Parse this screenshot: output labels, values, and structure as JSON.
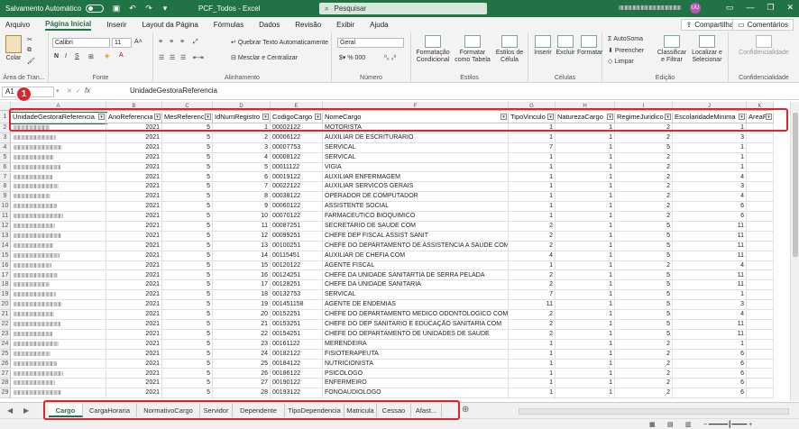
{
  "titlebar": {
    "autosave_label": "Salvamento Automático",
    "doc_title": "PCF_Todos  -  Excel",
    "search_placeholder": "Pesquisar",
    "user_initials": "UU"
  },
  "menu": [
    "Arquivo",
    "Página Inicial",
    "Inserir",
    "Layout da Página",
    "Fórmulas",
    "Dados",
    "Revisão",
    "Exibir",
    "Ajuda"
  ],
  "menu_active": 1,
  "share_label": "Compartilhar",
  "comments_label": "Comentários",
  "ribbon": {
    "paste": "Colar",
    "clipboard_group": "Área de Tran...",
    "font_name": "Calibri",
    "font_size": "11",
    "font_group": "Fonte",
    "wrap_text": "Quebrar Texto Automaticamente",
    "merge_center": "Mesclar e Centralizar",
    "alignment_group": "Alinhamento",
    "number_format": "Geral",
    "number_group": "Número",
    "cond_format": "Formatação Condicional",
    "format_table": "Formatar como Tabela",
    "cell_styles": "Estilos de Célula",
    "styles_group": "Estilos",
    "insert": "Inserir",
    "delete": "Excluir",
    "format": "Formatar",
    "cells_group": "Células",
    "autosum": "AutoSoma",
    "fill": "Preencher",
    "clear": "Limpar",
    "sort_filter": "Classificar e Filtrar",
    "find_select": "Localizar e Selecionar",
    "editing_group": "Edição",
    "confidentiality": "Confidencialidade",
    "confidentiality_group": "Confidencialidade"
  },
  "formula": {
    "name_box": "A1",
    "content": "UnidadeGestoraReferencia"
  },
  "annotation": {
    "badge": "1"
  },
  "columns": [
    "A",
    "B",
    "C",
    "D",
    "E",
    "F",
    "G",
    "H",
    "I",
    "J",
    "K"
  ],
  "headers": [
    "UnidadeGestoraReferencia",
    "AnoReferencia",
    "MesReferencia",
    "IdNumRegistro",
    "CodigoCargo",
    "NomeCargo",
    "TipoVinculo",
    "NaturezaCargo",
    "RegimeJuridico",
    "EscolaridadeMinima",
    "AreaFc"
  ],
  "rows": [
    [
      "",
      "2021",
      "5",
      "1",
      "00002122",
      "MOTORISTA",
      "1",
      "1",
      "2",
      "1"
    ],
    [
      "",
      "2021",
      "5",
      "2",
      "00006122",
      "AUXILIAR DE ESCRITURARIO",
      "1",
      "1",
      "2",
      "3"
    ],
    [
      "",
      "2021",
      "5",
      "3",
      "00007753",
      "SERVICAL",
      "7",
      "1",
      "5",
      "1"
    ],
    [
      "",
      "2021",
      "5",
      "4",
      "00008122",
      "SERVICAL",
      "1",
      "1",
      "2",
      "1"
    ],
    [
      "",
      "2021",
      "5",
      "5",
      "00011122",
      "VIGIA",
      "1",
      "1",
      "2",
      "1"
    ],
    [
      "",
      "2021",
      "5",
      "6",
      "00019122",
      "AUXILIAR ENFERMAGEM",
      "1",
      "1",
      "2",
      "4"
    ],
    [
      "",
      "2021",
      "5",
      "7",
      "00022122",
      "AUXILIAR SERVICOS GERAIS",
      "1",
      "1",
      "2",
      "3"
    ],
    [
      "",
      "2021",
      "5",
      "8",
      "00038122",
      "OPERADOR DE COMPUTADOR",
      "1",
      "1",
      "2",
      "4"
    ],
    [
      "",
      "2021",
      "5",
      "9",
      "00060122",
      "ASSISTENTE SOCIAL",
      "1",
      "1",
      "2",
      "6"
    ],
    [
      "",
      "2021",
      "5",
      "10",
      "00070122",
      "FARMACEUTICO BIOQUIMICO",
      "1",
      "1",
      "2",
      "6"
    ],
    [
      "",
      "2021",
      "5",
      "11",
      "00087251",
      "SECRETARIO DE SAUDE COM",
      "2",
      "1",
      "5",
      "11"
    ],
    [
      "",
      "2021",
      "5",
      "12",
      "00099251",
      "CHEFE DEP FISCAL ASSIST SANIT",
      "2",
      "1",
      "5",
      "11"
    ],
    [
      "",
      "2021",
      "5",
      "13",
      "00100251",
      "CHEFE DO DEPARTAMENTO DE ASSISTENCIA A SAUDE COM",
      "2",
      "1",
      "5",
      "11"
    ],
    [
      "",
      "2021",
      "5",
      "14",
      "00115451",
      "AUXILIAR DE CHEFIA COM",
      "4",
      "1",
      "5",
      "11"
    ],
    [
      "",
      "2021",
      "5",
      "15",
      "00120122",
      "AGENTE FISCAL",
      "1",
      "1",
      "2",
      "4"
    ],
    [
      "",
      "2021",
      "5",
      "16",
      "00124251",
      "CHEFE DA UNIDADE SANITARTIA DE SERRA PELADA",
      "2",
      "1",
      "5",
      "11"
    ],
    [
      "",
      "2021",
      "5",
      "17",
      "00128251",
      "CHEFE DA UNIDADE SANITARIA",
      "2",
      "1",
      "5",
      "11"
    ],
    [
      "",
      "2021",
      "5",
      "18",
      "00132753",
      "SERVICAL",
      "7",
      "1",
      "5",
      "1"
    ],
    [
      "",
      "2021",
      "5",
      "19",
      "001451158",
      "AGENTE DE ENDEMIAS",
      "11",
      "1",
      "5",
      "3"
    ],
    [
      "",
      "2021",
      "5",
      "20",
      "00152251",
      "CHEFE DO DEPARTAMENTO MEDICO ODONTOLOGICO COM",
      "2",
      "1",
      "5",
      "4"
    ],
    [
      "",
      "2021",
      "5",
      "21",
      "00153251",
      "CHEFE DO DEP SANITARIO E EDUCAÇÃO SANITARIA COM",
      "2",
      "1",
      "5",
      "11"
    ],
    [
      "",
      "2021",
      "5",
      "22",
      "00154251",
      "CHEFE DO DEPARTAMENTO DE UNIDADES DE SAUDE",
      "2",
      "1",
      "5",
      "11"
    ],
    [
      "",
      "2021",
      "5",
      "23",
      "00161122",
      "MERENDEIRA",
      "1",
      "1",
      "2",
      "1"
    ],
    [
      "",
      "2021",
      "5",
      "24",
      "00182122",
      "FISIOTERAPEUTA",
      "1",
      "1",
      "2",
      "6"
    ],
    [
      "",
      "2021",
      "5",
      "25",
      "00184122",
      "NUTRICIONISTA",
      "1",
      "1",
      "2",
      "6"
    ],
    [
      "",
      "2021",
      "5",
      "26",
      "00186122",
      "PSICOLOGO",
      "1",
      "1",
      "2",
      "6"
    ],
    [
      "",
      "2021",
      "5",
      "27",
      "00190122",
      "ENFERMEIRO",
      "1",
      "1",
      "2",
      "6"
    ],
    [
      "",
      "2021",
      "5",
      "28",
      "00193122",
      "FONOAUDIOLOGO",
      "1",
      "1",
      "2",
      "6"
    ]
  ],
  "sheets": [
    "Cargo",
    "CargaHoraria",
    "NormativoCargo",
    "Servidor",
    "Dependente",
    "TipoDependencia",
    "Matricula",
    "Cessao",
    "Afast..."
  ],
  "sheet_active": 0,
  "colors": {
    "excel_green": "#217346",
    "highlight_red": "#e0242b"
  }
}
